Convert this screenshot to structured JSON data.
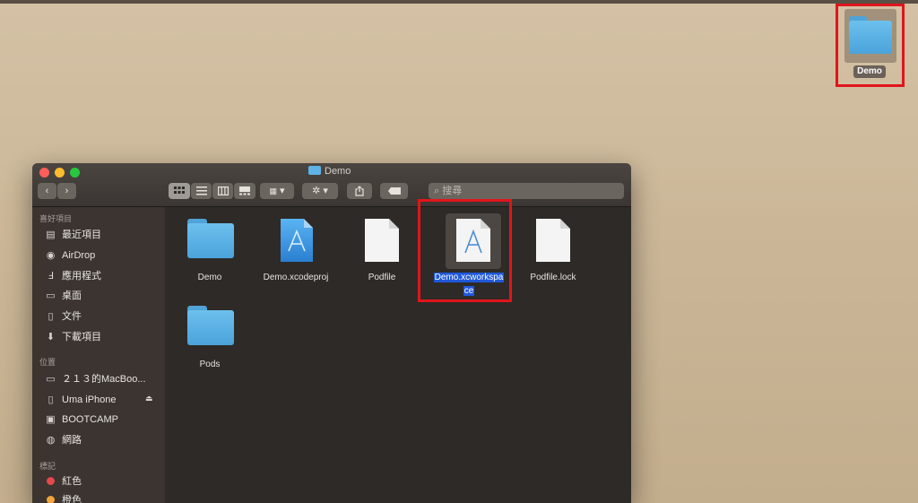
{
  "desktop": {
    "folder_label": "Demo"
  },
  "window": {
    "title": "Demo",
    "search_placeholder": "搜尋",
    "toolbar": {
      "action_glyph": "✲",
      "dropdown_glyph": "▾"
    }
  },
  "sidebar": {
    "favorites_title": "喜好項目",
    "favorites": [
      {
        "label": "最近項目",
        "icon": "clock-icon"
      },
      {
        "label": "AirDrop",
        "icon": "airdrop-icon"
      },
      {
        "label": "應用程式",
        "icon": "applications-icon"
      },
      {
        "label": "桌面",
        "icon": "desktop-icon"
      },
      {
        "label": "文件",
        "icon": "document-icon"
      },
      {
        "label": "下載項目",
        "icon": "download-icon"
      }
    ],
    "locations_title": "位置",
    "locations": [
      {
        "label": "２１３的MacBoo...",
        "icon": "laptop-icon"
      },
      {
        "label": "Uma iPhone",
        "icon": "iphone-icon"
      },
      {
        "label": "BOOTCAMP",
        "icon": "disk-icon"
      },
      {
        "label": "網路",
        "icon": "network-icon"
      }
    ],
    "tags_title": "標記",
    "tags": [
      {
        "label": "紅色",
        "color": "#e5484d"
      },
      {
        "label": "橙色",
        "color": "#f3a43b"
      }
    ]
  },
  "files": [
    {
      "name": "Demo",
      "kind": "folder"
    },
    {
      "name": "Demo.xcodeproj",
      "kind": "xcodeproj"
    },
    {
      "name": "Podfile",
      "kind": "document"
    },
    {
      "name_line1": "Demo.xcworkspa",
      "name_line2": "ce",
      "kind": "xcworkspace",
      "selected": true
    },
    {
      "name": "Podfile.lock",
      "kind": "document"
    },
    {
      "name": "Pods",
      "kind": "folder"
    }
  ],
  "colors": {
    "highlight": "#e0151b",
    "selection": "#2058d9",
    "folder": "#4fa3d6"
  }
}
